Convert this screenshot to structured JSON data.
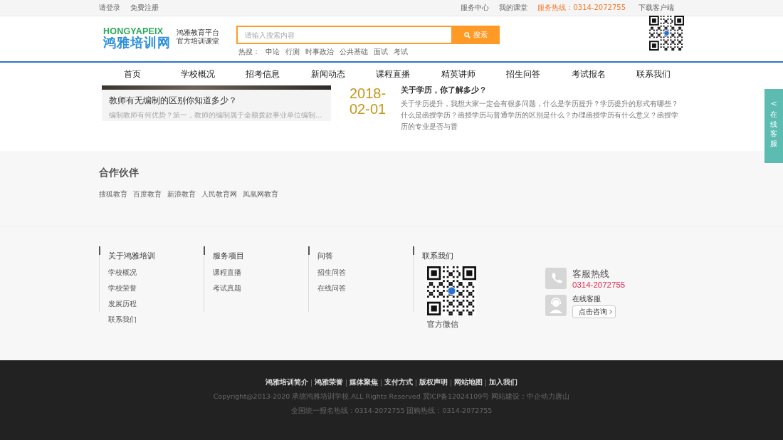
{
  "top_bar": {
    "left_links": [
      "请登录",
      "免费注册"
    ],
    "right_links": [
      {
        "label": "服务中心",
        "kind": "link"
      },
      {
        "label": "我的课堂",
        "kind": "link"
      },
      {
        "label": "服务热线：0314-2072755",
        "kind": "hotline"
      },
      {
        "label": "下载客户端",
        "kind": "link"
      }
    ]
  },
  "header": {
    "logo": {
      "latin": "HONGYAPEIX",
      "name": "鸿雅培训网"
    },
    "slogan": [
      "鸿雅教育平台",
      "官方培训课堂"
    ],
    "search": {
      "placeholder": "请输入搜索内容",
      "button": "搜索"
    },
    "hot_label": "热搜：",
    "hot_terms": [
      "申论",
      "行测",
      "时事政治",
      "公共基础",
      "面试",
      "考试"
    ]
  },
  "nav": [
    {
      "label": "首页",
      "selected": false
    },
    {
      "label": "学校概况",
      "selected": false
    },
    {
      "label": "招考信息",
      "selected": false
    },
    {
      "label": "新闻动态",
      "selected": false
    },
    {
      "label": "课程直播",
      "selected": false
    },
    {
      "label": "精英讲师",
      "selected": false
    },
    {
      "label": "招生问答",
      "selected": false
    },
    {
      "label": "考试报名",
      "selected": false
    },
    {
      "label": "联系我们",
      "selected": false
    }
  ],
  "feature": {
    "title": "教师有无编制的区别你知道多少？",
    "summary": "编制教师有何优势？第一，教师的编制属于全额拨款事业单位编制..."
  },
  "article": {
    "date_year": "2018-",
    "date_day": "02-01",
    "title": "关于学历，你了解多少？",
    "summary": "关于学历提升，我想大家一定会有很多问题，什么是学历提升？学历提升的形式有哪些？什么是函授学历？函授学历与普通学历的区别是什么？办理函授学历有什么意义？函授学历的专业是否与普"
  },
  "partners": {
    "title": "合作伙伴",
    "links": [
      "搜狐教育",
      "百度教育",
      "新浪教育",
      "人民教育网",
      "凤凰网教育"
    ]
  },
  "footer_columns": [
    {
      "title": "关于鸿雅培训",
      "links": [
        "学校概况",
        "学校荣誉",
        "发展历程",
        "联系我们"
      ]
    },
    {
      "title": "服务项目",
      "links": [
        "课程直播",
        "考试真题"
      ]
    },
    {
      "title": "问答",
      "links": [
        "招生问答",
        "在线问答"
      ]
    }
  ],
  "contact": {
    "title": "联系我们",
    "qr_caption": "官方微信",
    "hotline_label": "客服热线",
    "hotline_number": "0314-2072755",
    "online_label": "在线客服",
    "consult_button": "点击咨询"
  },
  "bottom": {
    "links": [
      "鸿雅培训简介",
      "鸿雅荣誉",
      "媒体聚焦",
      "支付方式",
      "版权声明",
      "网站地图",
      "加入我们"
    ],
    "copyright": "Copyright@2013-2020 承德鸿雅培训学校.ALL Rights Reserved 冀ICP备12024109号 网站建设：中企动力唐山",
    "hotlines": "全国统一报名热线：0314-2072755 团购热线：0314-2072755"
  },
  "side_tab": {
    "arrow": "<",
    "label": "在线客服"
  }
}
